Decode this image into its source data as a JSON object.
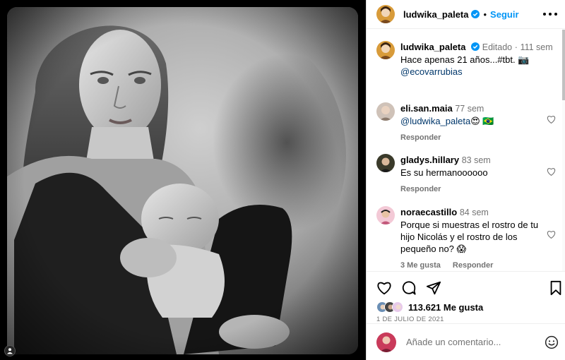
{
  "post": {
    "media_alt": "Black and white photo of a woman holding a sleeping baby in a carrier"
  },
  "header": {
    "username": "ludwika_paleta",
    "separator": "•",
    "follow_label": "Seguir"
  },
  "caption": {
    "username": "ludwika_paleta",
    "edited": "Editado",
    "separator": "·",
    "time": "111 sem",
    "text": "Hace apenas 21 años...#tbt. 📷",
    "mention": "@ecovarrubias"
  },
  "comments": [
    {
      "username": "eli.san.maia",
      "time": "77 sem",
      "mention": "@ludwika_paleta",
      "text": "😍 🇧🇷",
      "reply_label": "Responder"
    },
    {
      "username": "gladys.hillary",
      "time": "83 sem",
      "text": "Es su hermanoooooo",
      "reply_label": "Responder"
    },
    {
      "username": "noraecastillo",
      "time": "84 sem",
      "text": "Porque si muestras el rostro de tu hijo Nicolás y el rostro de los pequeño no? 😱",
      "likes_label": "3 Me gusta",
      "reply_label": "Responder"
    }
  ],
  "actions": {
    "like_icon": "heart-icon",
    "comment_icon": "comment-icon",
    "share_icon": "paper-plane-icon",
    "save_icon": "bookmark-icon"
  },
  "likes": {
    "count_text": "113.621 Me gusta"
  },
  "date": "1 DE JULIO DE 2021",
  "composer": {
    "placeholder": "Añade un comentario..."
  },
  "colors": {
    "link_blue": "#0095f6",
    "mention_blue": "#00376b",
    "verified_blue": "#0095f6",
    "muted_gray": "#737373"
  }
}
